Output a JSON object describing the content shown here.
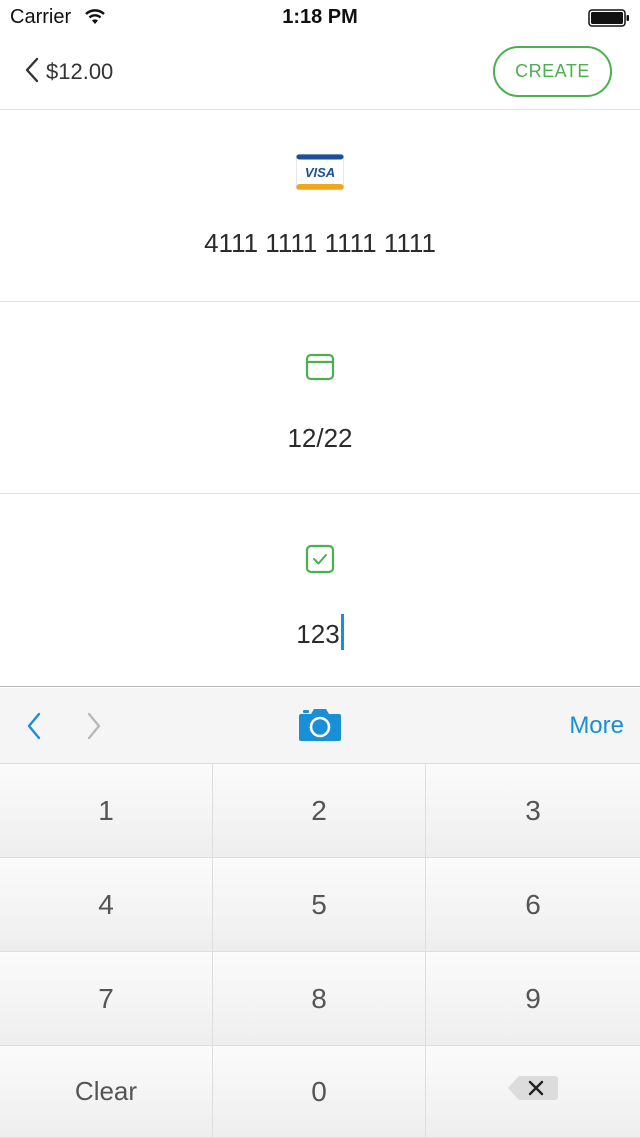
{
  "status_bar": {
    "carrier": "Carrier",
    "time": "1:18 PM"
  },
  "nav": {
    "back_label": "$12.00",
    "create_label": "CREATE"
  },
  "fields": {
    "card_number": "4111 1111 1111 1111",
    "card_brand_text": "VISA",
    "expiry": "12/22",
    "cvv": "123"
  },
  "toolbar": {
    "more_label": "More"
  },
  "keypad": {
    "keys": [
      "1",
      "2",
      "3",
      "4",
      "5",
      "6",
      "7",
      "8",
      "9"
    ],
    "clear_label": "Clear",
    "zero_label": "0"
  },
  "colors": {
    "accent_green": "#4caf50",
    "accent_blue": "#1a8fd6",
    "divider": "#e3e3e3"
  },
  "icons": [
    "wifi-icon",
    "battery-icon",
    "back-chevron-icon",
    "visa-card-icon",
    "calendar-icon",
    "checkbox-icon",
    "prev-arrow-icon",
    "next-arrow-icon",
    "camera-icon",
    "delete-icon"
  ]
}
